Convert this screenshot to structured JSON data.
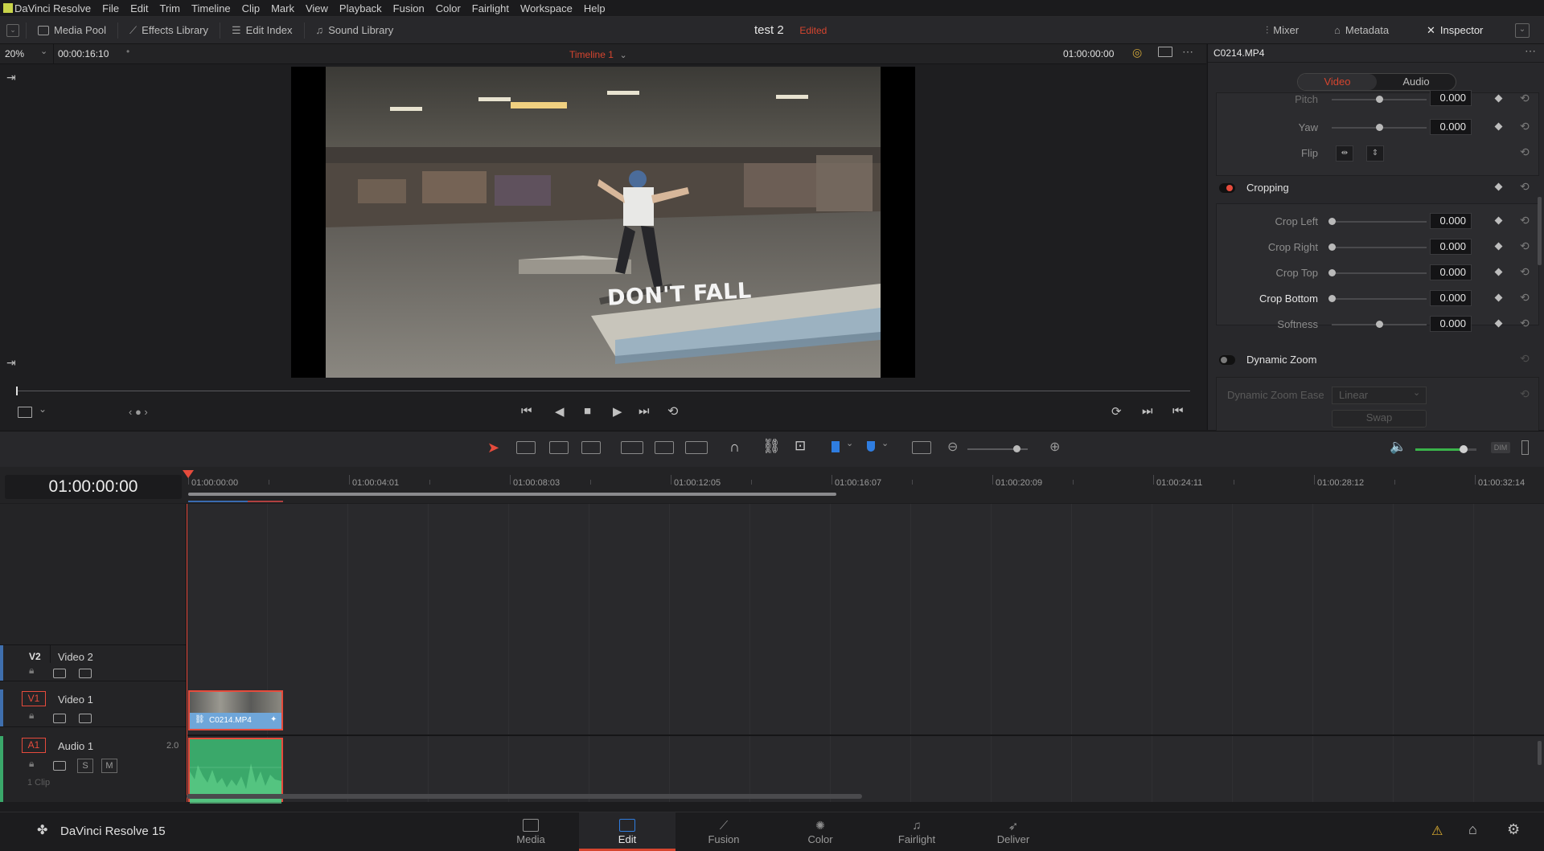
{
  "menu": {
    "app": "DaVinci Resolve",
    "items": [
      "File",
      "Edit",
      "Trim",
      "Timeline",
      "Clip",
      "Mark",
      "View",
      "Playback",
      "Fusion",
      "Color",
      "Fairlight",
      "Workspace",
      "Help"
    ]
  },
  "toolbar": {
    "media_pool": "Media Pool",
    "effects_library": "Effects Library",
    "edit_index": "Edit Index",
    "sound_library": "Sound Library",
    "project_name": "test 2",
    "project_status": "Edited",
    "mixer": "Mixer",
    "metadata": "Metadata",
    "inspector": "Inspector"
  },
  "viewer": {
    "zoom": "20%",
    "source_timecode": "00:00:16:10",
    "timeline_name": "Timeline 1",
    "record_timecode": "01:00:00:00",
    "overlay_text": "DON'T FALL",
    "progress": 0.0
  },
  "inspector": {
    "clip_name": "C0214.MP4",
    "tabs": [
      "Video",
      "Audio"
    ],
    "active_tab": "Video",
    "transform_rows": [
      {
        "label": "Pitch",
        "value": "0.000",
        "slider": 0.5
      },
      {
        "label": "Yaw",
        "value": "0.000",
        "slider": 0.5
      }
    ],
    "flip_label": "Flip",
    "cropping": {
      "title": "Cropping",
      "rows": [
        {
          "label": "Crop Left",
          "value": "0.000",
          "slider": 0.0
        },
        {
          "label": "Crop Right",
          "value": "0.000",
          "slider": 0.0
        },
        {
          "label": "Crop Top",
          "value": "0.000",
          "slider": 0.0
        },
        {
          "label": "Crop Bottom",
          "value": "0.000",
          "slider": 0.0
        },
        {
          "label": "Softness",
          "value": "0.000",
          "slider": 0.5
        }
      ]
    },
    "dynamic_zoom": {
      "title": "Dynamic Zoom",
      "ease_label": "Dynamic Zoom Ease",
      "ease_value": "Linear",
      "swap_label": "Swap"
    }
  },
  "timeline": {
    "current_timecode": "01:00:00:00",
    "ruler": [
      "01:00:00:00",
      "01:00:04:01",
      "01:00:08:03",
      "01:00:12:05",
      "01:00:16:07",
      "01:00:20:09",
      "01:00:24:11",
      "01:00:28:12",
      "01:00:32:14"
    ],
    "tracks": [
      {
        "id": "V2",
        "name": "Video 2"
      },
      {
        "id": "V1",
        "name": "Video 1"
      },
      {
        "id": "A1",
        "name": "Audio 1",
        "channels": "2.0",
        "clips": "1 Clip"
      }
    ],
    "clip_name": "C0214.MP4",
    "solo_label": "S",
    "mute_label": "M",
    "dim_label": "DIM"
  },
  "pages": [
    {
      "label": "Media"
    },
    {
      "label": "Edit"
    },
    {
      "label": "Fusion"
    },
    {
      "label": "Color"
    },
    {
      "label": "Fairlight"
    },
    {
      "label": "Deliver"
    }
  ],
  "active_page": "Edit",
  "footer_app": "DaVinci Resolve 15",
  "colors": {
    "accent_red": "#e64b3c",
    "clip_blue": "#6fa6d9",
    "audio_green": "#3aa86a",
    "active_tab_red": "#d6452f"
  }
}
